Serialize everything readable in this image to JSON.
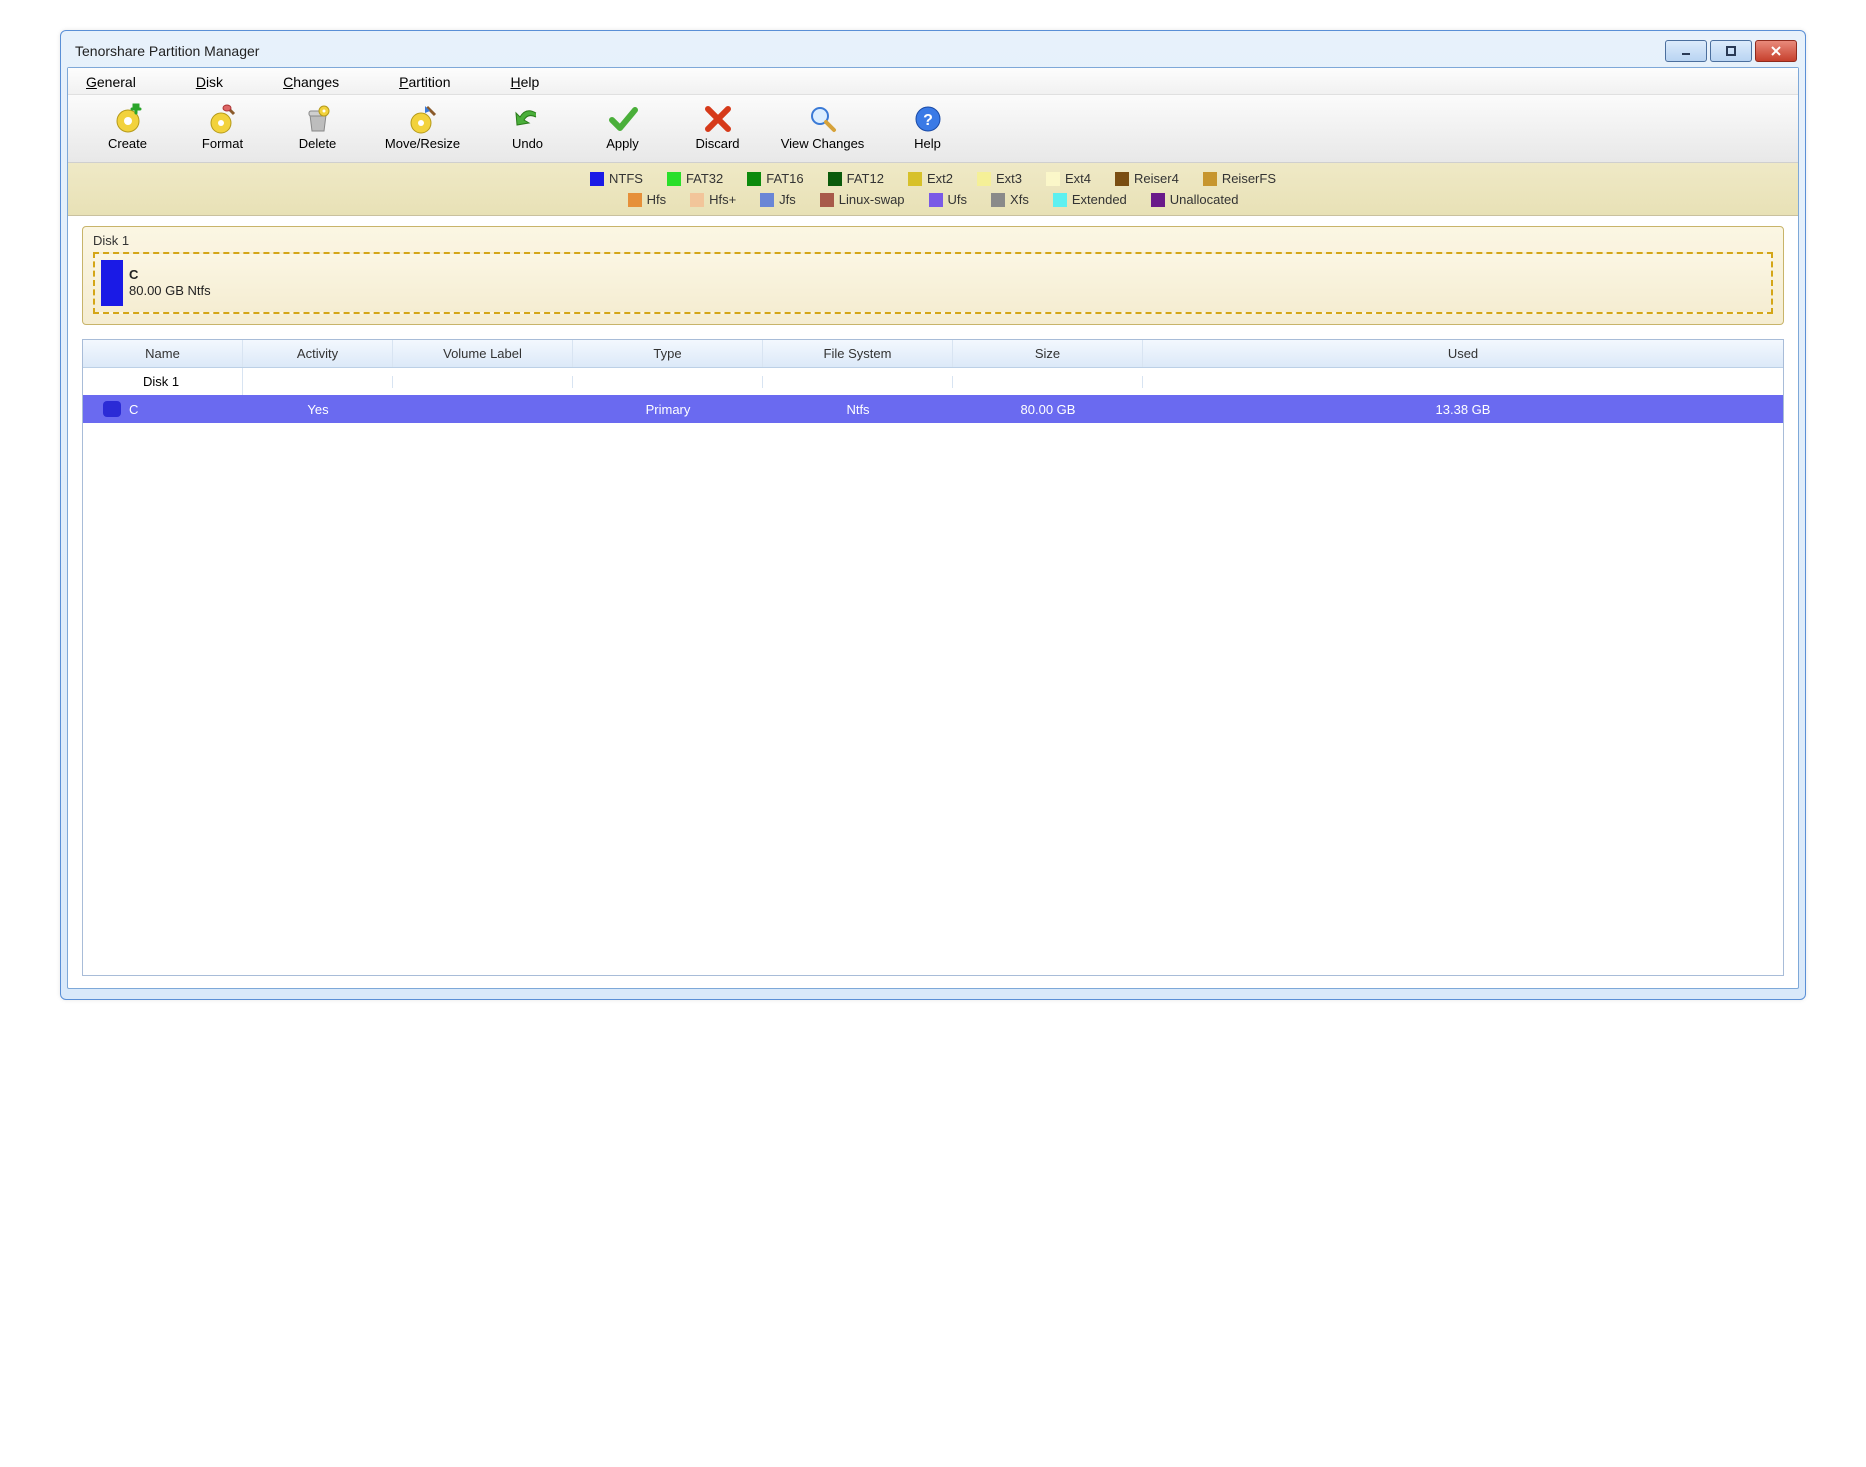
{
  "window": {
    "title": "Tenorshare Partition Manager"
  },
  "menubar": {
    "items": [
      {
        "letter": "G",
        "rest": "eneral"
      },
      {
        "letter": "D",
        "rest": "isk"
      },
      {
        "letter": "C",
        "rest": "hanges"
      },
      {
        "letter": "P",
        "rest": "artition"
      },
      {
        "letter": "H",
        "rest": "elp"
      }
    ]
  },
  "toolbar": {
    "create": "Create",
    "format": "Format",
    "delete": "Delete",
    "move_resize": "Move/Resize",
    "undo": "Undo",
    "apply": "Apply",
    "discard": "Discard",
    "view_changes": "View Changes",
    "help": "Help"
  },
  "legend": {
    "row1": [
      {
        "label": "NTFS",
        "color": "#1a1ae6"
      },
      {
        "label": "FAT32",
        "color": "#2adf2a"
      },
      {
        "label": "FAT16",
        "color": "#0d8a0d"
      },
      {
        "label": "FAT12",
        "color": "#0b5a0b"
      },
      {
        "label": "Ext2",
        "color": "#d7c12a"
      },
      {
        "label": "Ext3",
        "color": "#f5f097"
      },
      {
        "label": "Ext4",
        "color": "#fbf7c9"
      },
      {
        "label": "Reiser4",
        "color": "#7a4e12"
      },
      {
        "label": "ReiserFS",
        "color": "#c7962f"
      }
    ],
    "row2": [
      {
        "label": "Hfs",
        "color": "#e6903a"
      },
      {
        "label": "Hfs+",
        "color": "#f2c59a"
      },
      {
        "label": "Jfs",
        "color": "#6a86d6"
      },
      {
        "label": "Linux-swap",
        "color": "#a85a4a"
      },
      {
        "label": "Ufs",
        "color": "#7a5ae6"
      },
      {
        "label": "Xfs",
        "color": "#8a8a8a"
      },
      {
        "label": "Extended",
        "color": "#5ef0f0"
      },
      {
        "label": "Unallocated",
        "color": "#6a1a8a"
      }
    ]
  },
  "disk": {
    "label": "Disk 1",
    "partition_name": "C",
    "partition_detail": "80.00 GB Ntfs",
    "partition_color": "#1a1ae6"
  },
  "table": {
    "headers": {
      "name": "Name",
      "activity": "Activity",
      "volume_label": "Volume Label",
      "type": "Type",
      "file_system": "File System",
      "size": "Size",
      "used": "Used"
    },
    "group": "Disk 1",
    "row": {
      "name": "C",
      "activity": "Yes",
      "volume_label": "",
      "type": "Primary",
      "file_system": "Ntfs",
      "size": "80.00 GB",
      "used": "13.38 GB"
    }
  }
}
